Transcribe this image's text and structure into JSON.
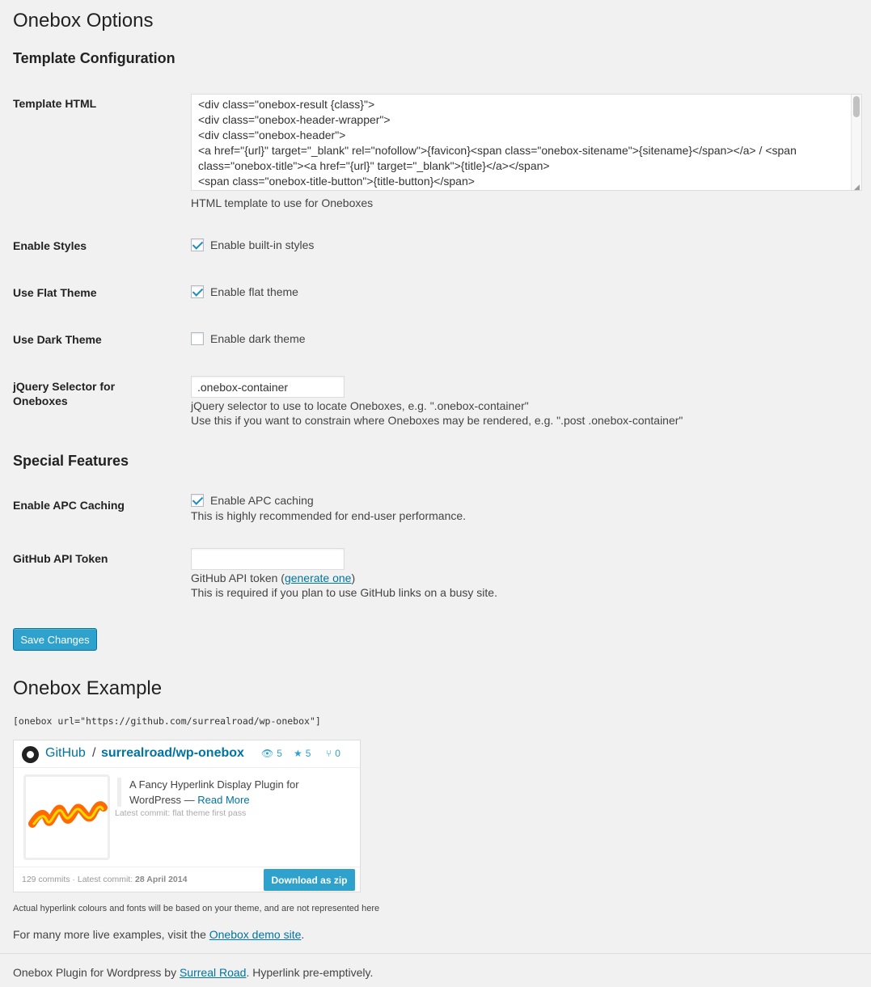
{
  "page": {
    "title": "Onebox Options"
  },
  "template_section": {
    "heading": "Template Configuration",
    "template_html": {
      "label": "Template HTML",
      "value": "<div class=\"onebox-result {class}\">\n<div class=\"onebox-header-wrapper\">\n<div class=\"onebox-header\">\n<a href=\"{url}\" target=\"_blank\" rel=\"nofollow\">{favicon}<span class=\"onebox-sitename\">{sitename}</span></a> / <span class=\"onebox-title\"><a href=\"{url}\" target=\"_blank\">{title}</a></span>\n<span class=\"onebox-title-button\">{title-button}</span>",
      "description": "HTML template to use for Oneboxes"
    },
    "enable_styles": {
      "label": "Enable Styles",
      "checkbox_label": "Enable built-in styles",
      "checked": true
    },
    "flat_theme": {
      "label": "Use Flat Theme",
      "checkbox_label": "Enable flat theme",
      "checked": true
    },
    "dark_theme": {
      "label": "Use Dark Theme",
      "checkbox_label": "Enable dark theme",
      "checked": false
    },
    "selector": {
      "label": "jQuery Selector for Oneboxes",
      "value": ".onebox-container",
      "help_1": "jQuery selector to use to locate Oneboxes, e.g. \".onebox-container\"",
      "help_2": "Use this if you want to constrain where Oneboxes may be rendered, e.g. \".post .onebox-container\""
    }
  },
  "special_section": {
    "heading": "Special Features",
    "apc": {
      "label": "Enable APC Caching",
      "checkbox_label": "Enable APC caching",
      "checked": true,
      "help": "This is highly recommended for end-user performance."
    },
    "github_token": {
      "label": "GitHub API Token",
      "value": "",
      "help_prefix": "GitHub API token (",
      "help_link": "generate one",
      "help_suffix": ")",
      "help_2": "This is required if you plan to use GitHub links on a busy site."
    }
  },
  "save_button": "Save Changes",
  "example": {
    "heading": "Onebox Example",
    "shortcode": "[onebox url=\"https://github.com/surrealroad/wp-onebox\"]",
    "card": {
      "site": "GitHub",
      "separator": "/",
      "repo": "surrealroad/wp-onebox",
      "watchers": "5",
      "stars": "5",
      "forks": "0",
      "description": "A Fancy Hyperlink Display Plugin for WordPress — ",
      "read_more": "Read More",
      "latest_commit": "Latest commit: flat theme first pass",
      "footer_prefix": "129 commits · Latest commit: ",
      "footer_date": "28 April 2014",
      "download_button": "Download as zip",
      "colors": {
        "accent": "#2ea2cc",
        "link": "#0074a2"
      },
      "icons": [
        "github-icon",
        "eye-icon",
        "star-icon",
        "fork-icon"
      ]
    },
    "note": "Actual hyperlink colours and fonts will be based on your theme, and are not represented here",
    "demo_prefix": "For many more live examples, visit the ",
    "demo_link": "Onebox demo site",
    "demo_suffix": "."
  },
  "footer": {
    "prefix": "Onebox Plugin for Wordpress by ",
    "link": "Surreal Road",
    "suffix": ". Hyperlink pre-emptively."
  }
}
